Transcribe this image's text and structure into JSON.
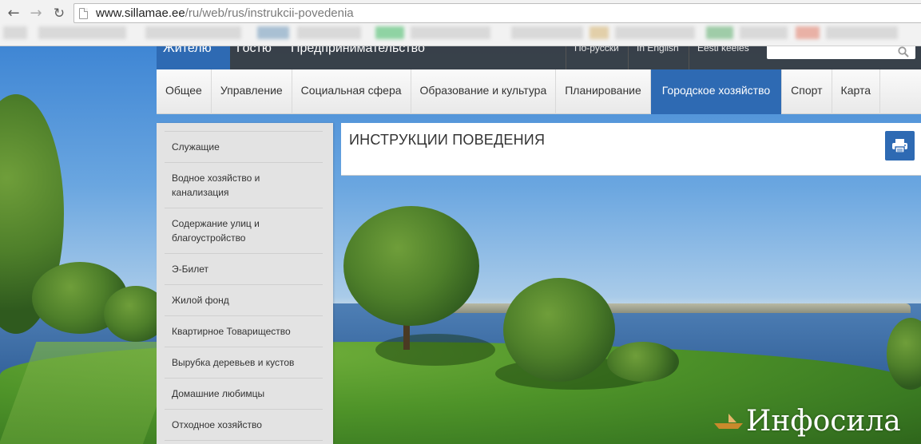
{
  "browser": {
    "url_host": "www.sillamae.ee",
    "url_path": "/ru/web/rus/instrukcii-povedenia"
  },
  "site": {
    "top_nav": [
      {
        "label": "Жителю"
      },
      {
        "label": "Гостю"
      },
      {
        "label": "Предпринимательство"
      }
    ],
    "languages": [
      {
        "label": "По-русски"
      },
      {
        "label": "In English"
      },
      {
        "label": "Eesti keeles"
      }
    ],
    "main_menu": [
      {
        "label": "Общее"
      },
      {
        "label": "Управление"
      },
      {
        "label": "Социальная сфера"
      },
      {
        "label": "Образование и культура"
      },
      {
        "label": "Планирование"
      },
      {
        "label": "Городское хозяйство",
        "active": true
      },
      {
        "label": "Спорт"
      },
      {
        "label": "Карта"
      }
    ],
    "side_menu": [
      {
        "label": "Служащие"
      },
      {
        "label": "Водное хозяйство и канализация"
      },
      {
        "label": "Содержание улиц и благоустройство"
      },
      {
        "label": "Э-Билет"
      },
      {
        "label": "Жилой фонд"
      },
      {
        "label": "Квартирное Товарищество"
      },
      {
        "label": "Вырубка деревьев и кустов"
      },
      {
        "label": "Домашние любимцы"
      },
      {
        "label": "Отходное хозяйство"
      }
    ],
    "page_title": "ИНСТРУКЦИИ ПОВЕДЕНИЯ",
    "accent_color": "#2e6ab3"
  },
  "watermark": {
    "text": "Инфосила"
  }
}
